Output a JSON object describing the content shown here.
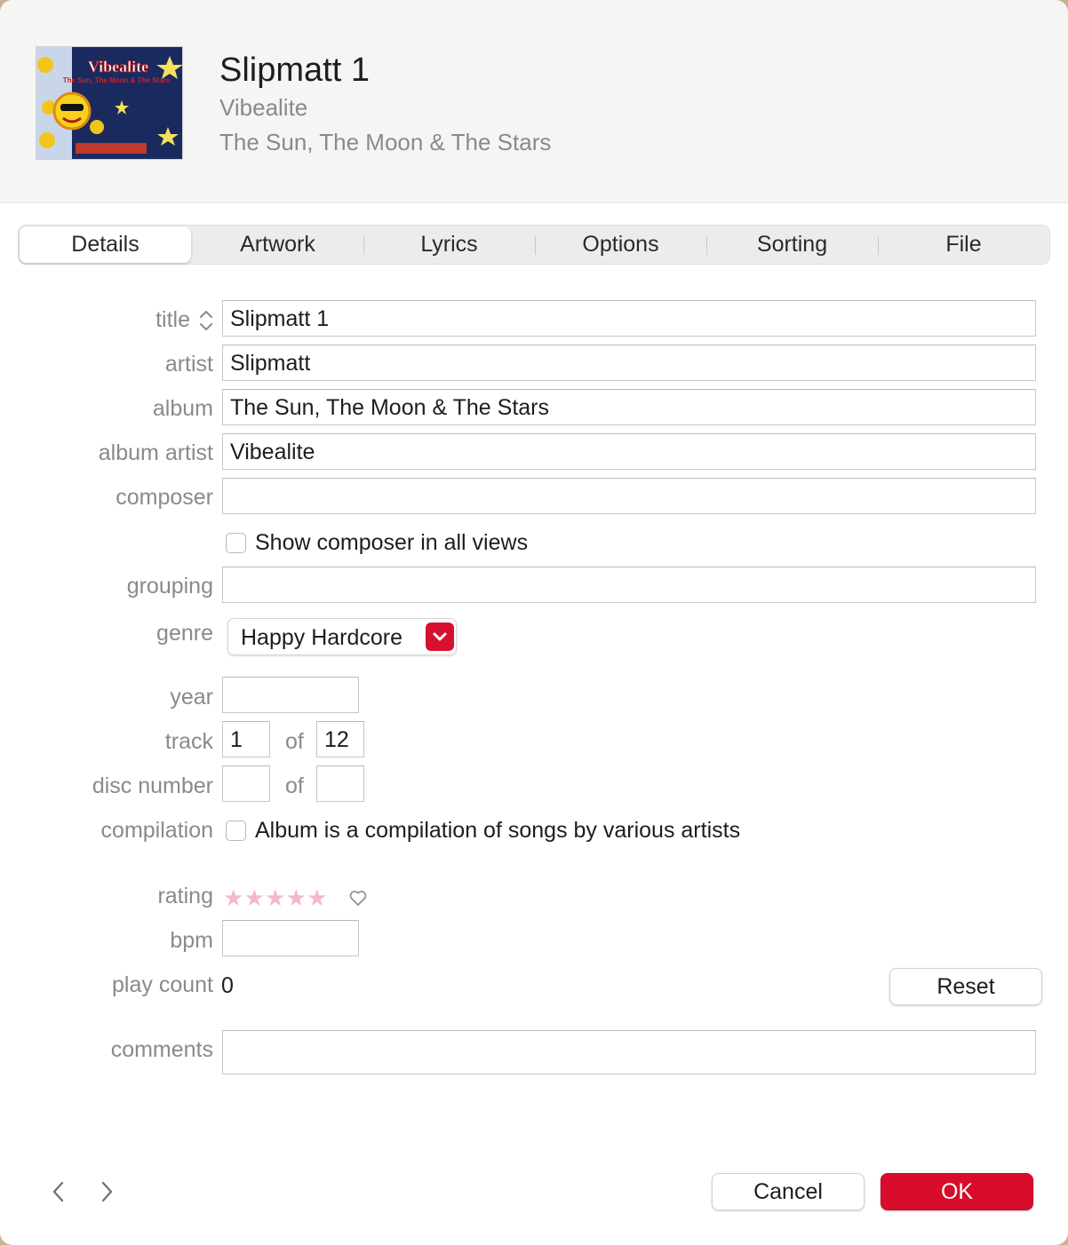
{
  "header": {
    "title": "Slipmatt 1",
    "artist": "Vibealite",
    "album": "The Sun, The Moon & The Stars",
    "artwork_text": "Vibealite",
    "artwork_subtitle": "The Sun, The Moon & The Stars"
  },
  "tabs": [
    {
      "label": "Details",
      "active": true
    },
    {
      "label": "Artwork",
      "active": false
    },
    {
      "label": "Lyrics",
      "active": false
    },
    {
      "label": "Options",
      "active": false
    },
    {
      "label": "Sorting",
      "active": false
    },
    {
      "label": "File",
      "active": false
    }
  ],
  "labels": {
    "title": "title",
    "artist": "artist",
    "album": "album",
    "album_artist": "album artist",
    "composer": "composer",
    "grouping": "grouping",
    "genre": "genre",
    "year": "year",
    "track": "track",
    "disc_number": "disc number",
    "compilation": "compilation",
    "rating": "rating",
    "bpm": "bpm",
    "play_count": "play count",
    "comments": "comments",
    "of": "of"
  },
  "fields": {
    "title": "Slipmatt 1",
    "artist": "Slipmatt",
    "album": "The Sun, The Moon & The Stars",
    "album_artist": "Vibealite",
    "composer": "",
    "grouping": "",
    "genre": "Happy Hardcore",
    "year": "",
    "track_number": "1",
    "track_total": "12",
    "disc_number": "",
    "disc_total": "",
    "bpm": "",
    "play_count": "0",
    "comments": ""
  },
  "checkboxes": {
    "show_composer": {
      "label": "Show composer in all views",
      "checked": false
    },
    "compilation": {
      "label": "Album is a compilation of songs by various artists",
      "checked": false
    }
  },
  "rating": {
    "stars": 0,
    "max": 5,
    "loved": false
  },
  "buttons": {
    "reset": "Reset",
    "cancel": "Cancel",
    "ok": "OK"
  },
  "icons": {
    "sort": "chevron-up-down-icon",
    "genre_popup": "chevron-down-icon",
    "love": "heart-icon",
    "previous": "chevron-left-icon",
    "next": "chevron-right-icon"
  },
  "colors": {
    "accent": "#d80d2c",
    "star_empty": "#f4b8c9",
    "header_bg": "#f5f5f4"
  }
}
